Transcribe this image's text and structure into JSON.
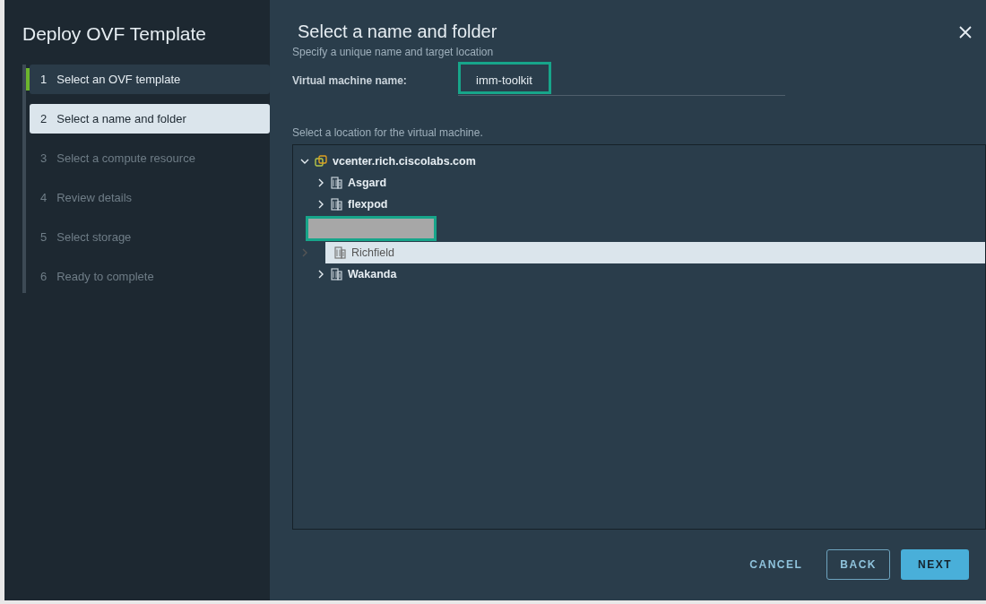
{
  "wizard": {
    "title": "Deploy OVF Template",
    "steps": [
      {
        "number": "1",
        "label": "Select an OVF template",
        "completed": true,
        "disabled": false,
        "selected": false
      },
      {
        "number": "2",
        "label": "Select a name and folder",
        "completed": false,
        "disabled": false,
        "selected": true
      },
      {
        "number": "3",
        "label": "Select a compute resource",
        "completed": false,
        "disabled": true,
        "selected": false
      },
      {
        "number": "4",
        "label": "Review details",
        "completed": false,
        "disabled": true,
        "selected": false
      },
      {
        "number": "5",
        "label": "Select storage",
        "completed": false,
        "disabled": true,
        "selected": false
      },
      {
        "number": "6",
        "label": "Ready to complete",
        "completed": false,
        "disabled": true,
        "selected": false
      }
    ]
  },
  "page": {
    "title": "Select a name and folder",
    "subtitle": "Specify a unique name and target location",
    "name_label": "Virtual machine name:",
    "name_value": "imm-toolkit",
    "location_label": "Select a location for the virtual machine.",
    "tree": [
      {
        "label": "vcenter.rich.ciscolabs.com",
        "kind": "vcenter",
        "expanded": true,
        "selected": false,
        "children": [
          {
            "label": "Asgard",
            "kind": "datacenter",
            "expanded": false,
            "selected": false
          },
          {
            "label": "flexpod",
            "kind": "datacenter",
            "expanded": false,
            "selected": false
          },
          {
            "kind": "redacted"
          },
          {
            "label": "Richfield",
            "kind": "datacenter",
            "expanded": false,
            "selected": true
          },
          {
            "label": "Wakanda",
            "kind": "datacenter",
            "expanded": false,
            "selected": false
          }
        ]
      }
    ]
  },
  "buttons": [
    {
      "label": "CANCEL",
      "kind": "flat"
    },
    {
      "label": "BACK",
      "kind": "outline"
    },
    {
      "label": "NEXT",
      "kind": "primary"
    }
  ]
}
